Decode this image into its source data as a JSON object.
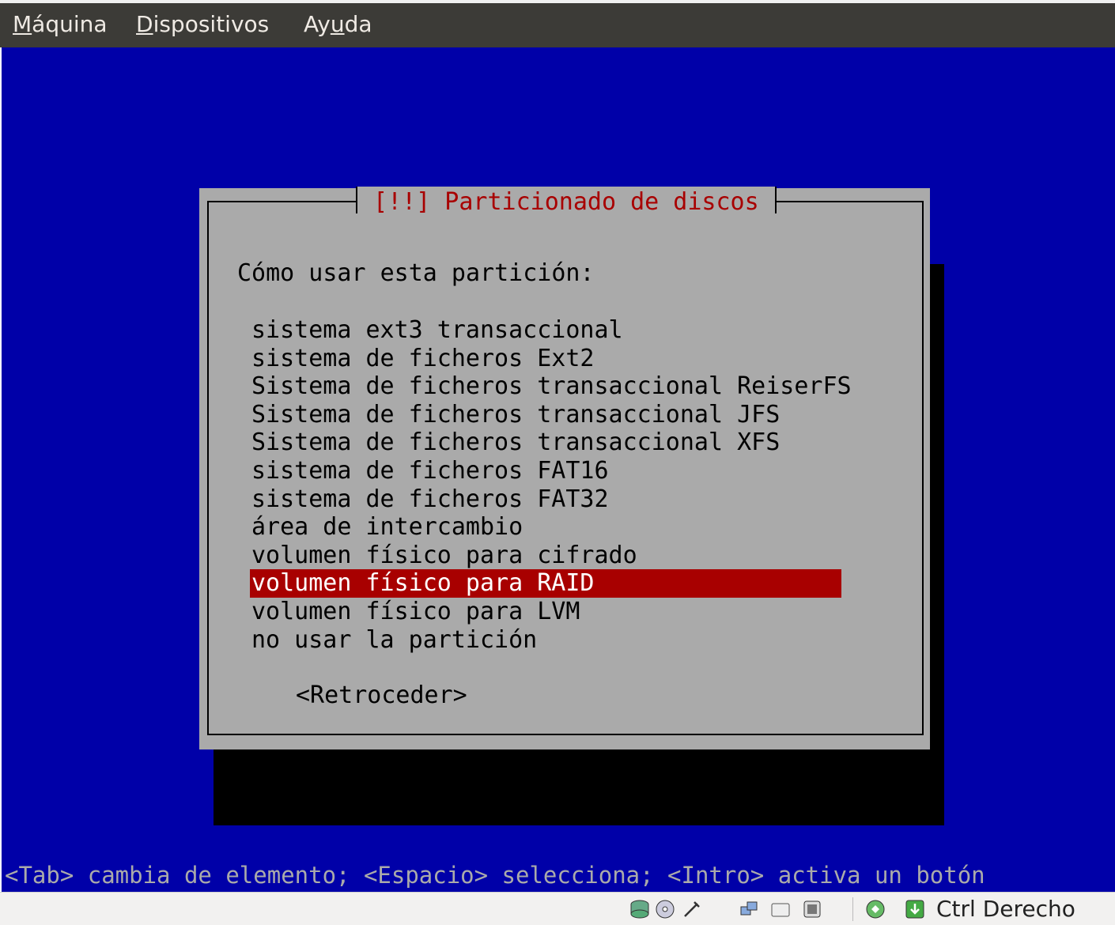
{
  "menubar": {
    "items": [
      {
        "label": "Máquina",
        "mnemonic_index": 0
      },
      {
        "label": "Dispositivos",
        "mnemonic_index": 0
      },
      {
        "label": "Ayuda",
        "mnemonic_index": 2
      }
    ]
  },
  "dialog": {
    "title": "[!!] Particionado de discos",
    "prompt": "Cómo usar esta partición:",
    "options": [
      "sistema ext3 transaccional",
      "sistema de ficheros Ext2",
      "Sistema de ficheros transaccional ReiserFS",
      "Sistema de ficheros transaccional JFS",
      "Sistema de ficheros transaccional XFS",
      "sistema de ficheros FAT16",
      "sistema de ficheros FAT32",
      "área de intercambio",
      "volumen físico para cifrado",
      "volumen físico para RAID",
      "volumen físico para LVM",
      "no usar la partición"
    ],
    "selected_index": 9,
    "back_button": "<Retroceder>"
  },
  "help_line": "<Tab> cambia de elemento; <Espacio> selecciona; <Intro> activa un botón",
  "statusbar": {
    "icons": [
      "hard-disk-icon",
      "optical-drive-icon",
      "usb-icon",
      "network-icon",
      "shared-folder-icon",
      "video-capture-icon",
      "mouse-integration-icon",
      "host-key-icon"
    ],
    "host_key": "Ctrl Derecho"
  },
  "colors": {
    "console_bg": "#0000a8",
    "dialog_bg": "#aaaaaa",
    "title_fg": "#a80000",
    "selected_bg": "#a80000"
  }
}
